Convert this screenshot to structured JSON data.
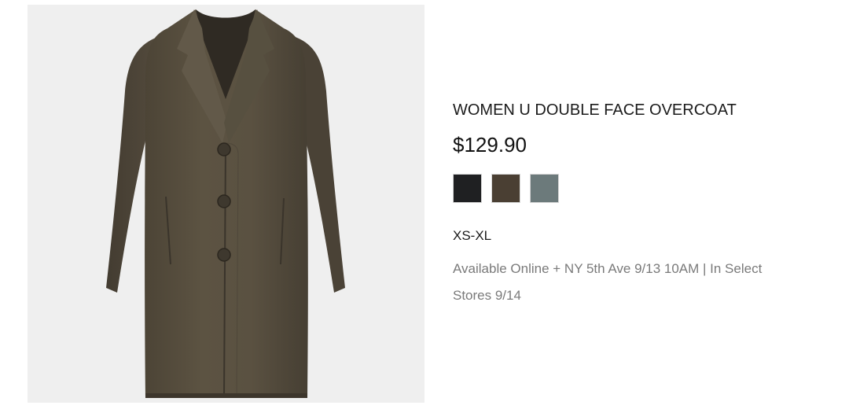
{
  "product": {
    "image_icon": "overcoat-product-image",
    "title": "WOMEN U DOUBLE FACE OVERCOAT",
    "price": "$129.90",
    "swatches": [
      {
        "name": "black",
        "color": "#1f2022"
      },
      {
        "name": "brown",
        "color": "#4a3f33"
      },
      {
        "name": "gray",
        "color": "#6c7a7b"
      }
    ],
    "sizes": "XS-XL",
    "availability": "Available Online + NY 5th Ave 9/13 10AM | In Select Stores 9/14",
    "colors": {
      "coat_main": "#595040",
      "coat_shadow": "#3e372d",
      "coat_highlight": "#6a6150",
      "image_background": "#efefef"
    }
  }
}
